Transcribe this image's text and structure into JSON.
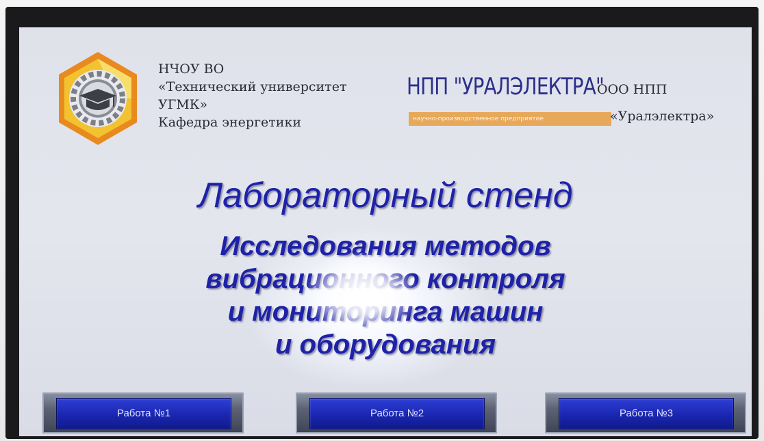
{
  "university": {
    "line1": "НЧОУ ВО",
    "line2": "«Технический университет",
    "line3": "УГМК»",
    "line4": "Кафедра энергетики"
  },
  "company": {
    "brand": "НПП \"УРАЛЭЛЕКТРА\"",
    "org_form": "ООО НПП",
    "strip_text": "научно-производственное предприятие",
    "name": "«Уралэлектра»"
  },
  "title": "Лабораторный стенд",
  "subtitle": {
    "line1": "Исследования методов",
    "line2": "вибрационного контроля",
    "line3": "и мониторинга машин",
    "line4": "и оборудования"
  },
  "buttons": [
    {
      "label": "Работа №1"
    },
    {
      "label": "Работа №2"
    },
    {
      "label": "Работа №3"
    }
  ],
  "colors": {
    "title": "#1e22a8",
    "button": "#1a26b0",
    "logo_orange": "#e88a1e",
    "logo_yellow": "#f2c230",
    "strip": "#e7a85a"
  },
  "icons": {
    "logo": "graduation-cap-gear-icon"
  }
}
